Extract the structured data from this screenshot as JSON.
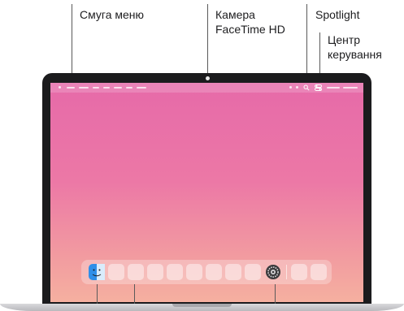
{
  "callouts": {
    "menu_bar": "Смуга меню",
    "camera_line1": "Камера",
    "camera_line2": "FaceTime HD",
    "spotlight": "Spotlight",
    "control_center_line1": "Центр",
    "control_center_line2": "керування"
  },
  "icons": {
    "finder": "finder-icon",
    "settings": "system-settings-icon",
    "spotlight": "search-icon",
    "control_center": "control-center-icon"
  },
  "colors": {
    "wallpaper_top": "#e66aa9",
    "wallpaper_bottom": "#f5b0a0",
    "bezel": "#1b1b1d",
    "finder_blue": "#2f8fe8"
  }
}
